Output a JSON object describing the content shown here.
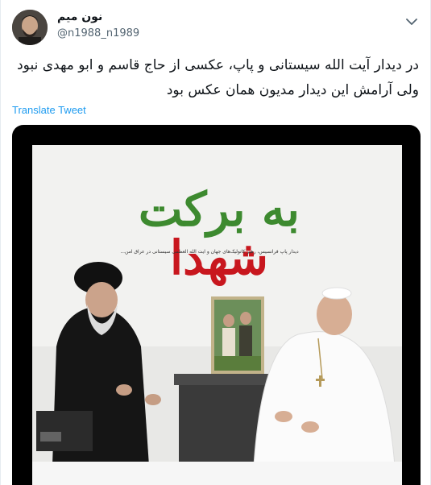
{
  "tweet": {
    "author": {
      "display_name": "نون میم",
      "handle": "@n1988_n1989"
    },
    "text": "در دیدار آیت الله سیستانی و پاپ، عکسی از حاج قاسم و ابو مهدی نبود ولی آرامش این دیدار مدیون همان عکس بود",
    "translate_label": "Translate Tweet"
  },
  "media": {
    "title_part1": "به برکت",
    "title_part2": "شهدا",
    "caption": "دیدار پاپ فرانسیس، رهبر کاتولیک‌های جهان و آیت الله العظمی سیستانی در عراق امن..."
  },
  "colors": {
    "link": "#1d9bf0",
    "text_primary": "#0f1419",
    "text_secondary": "#536471",
    "title_green": "#3d8a2f",
    "title_red": "#c8171e"
  },
  "icons": {
    "more": "chevron-down-icon"
  }
}
